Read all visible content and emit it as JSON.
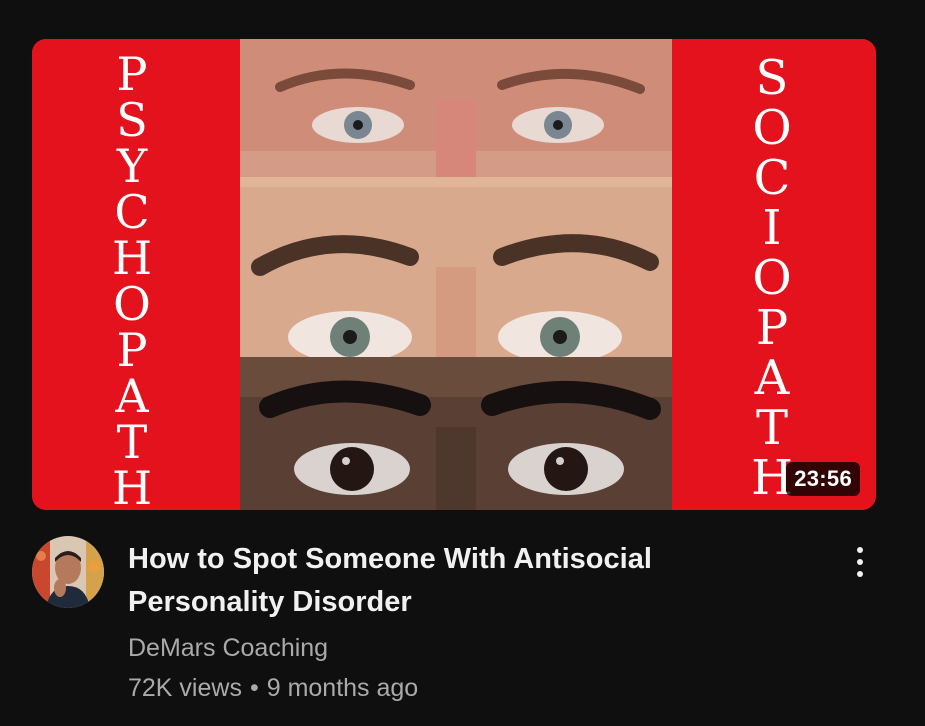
{
  "video": {
    "thumbnail": {
      "left_text": [
        "P",
        "S",
        "Y",
        "C",
        "H",
        "O",
        "P",
        "A",
        "T",
        "H"
      ],
      "right_text": [
        "S",
        "O",
        "C",
        "I",
        "O",
        "P",
        "A",
        "T",
        "H"
      ],
      "duration": "23:56",
      "background_color": "#e4121d"
    },
    "title": "How to Spot Someone With Antisocial Personality Disorder",
    "channel": "DeMars Coaching",
    "views": "72K views",
    "separator": "•",
    "age": "9 months ago"
  },
  "icons": {
    "menu": "more-vert-icon",
    "avatar": "channel-avatar"
  }
}
